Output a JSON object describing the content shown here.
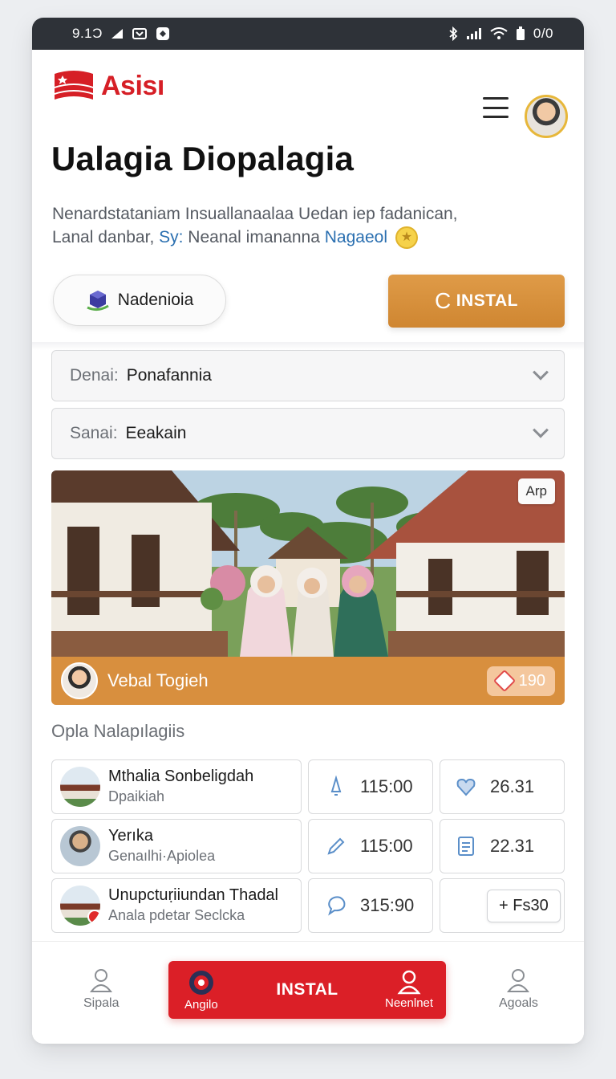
{
  "status_bar": {
    "time": "9.1Ɔ",
    "right_text": "0/0"
  },
  "header": {
    "logo_text": "Asisı",
    "menu_icon": "hamburger-icon",
    "avatar": "user-avatar"
  },
  "title": "Ualagia Diopalagia",
  "subtitle": {
    "line1": "Nenardstataniam Insuallanaalaa Uedan iep fadanican,",
    "line2_start": "Lanal danbar, ",
    "line2_hl1": "Sy:",
    "line2_mid": " Neanal imananna ",
    "line2_hl2": "Nagaeol"
  },
  "buttons": {
    "secondary": "Nadenioia",
    "primary": "INSTAL",
    "primary_glyph": "C"
  },
  "selects": [
    {
      "label": "Denai:",
      "value": "Ponafannia"
    },
    {
      "label": "Sanai:",
      "value": "Eeakain"
    }
  ],
  "card": {
    "badge": "Arp",
    "name": "Vebal Togieh",
    "count": "190"
  },
  "section_title": "Opla Nalapılagiis",
  "rows": [
    {
      "title": "Mthalia Sonbeligdah",
      "subtitle": "Dpaikiah",
      "v1": "115:00",
      "v2": "26.31",
      "icon1": "bell-icon",
      "icon2": "heart-icon"
    },
    {
      "title": "Yerıka",
      "subtitle": "Genaılhi·Apiolea",
      "v1": "115:00",
      "v2": "22.31",
      "icon1": "pencil-icon",
      "icon2": "document-icon"
    },
    {
      "title": "Unupctuṛiiundan Thadal",
      "subtitle": "Anala pdetar Seclcka",
      "v1": "315:90",
      "v2": "Fs30",
      "icon1": "chat-bubble-icon",
      "icon2": "plus-icon"
    }
  ],
  "bottom_nav": {
    "left": "Sipala",
    "center_left": "Angilo",
    "center": "INSTAL",
    "center_right": "Neenlnet",
    "right": "Agoals"
  },
  "colors": {
    "brand_red": "#db1f27",
    "accent_orange": "#d88f3e",
    "link_blue": "#2a6fb0"
  }
}
